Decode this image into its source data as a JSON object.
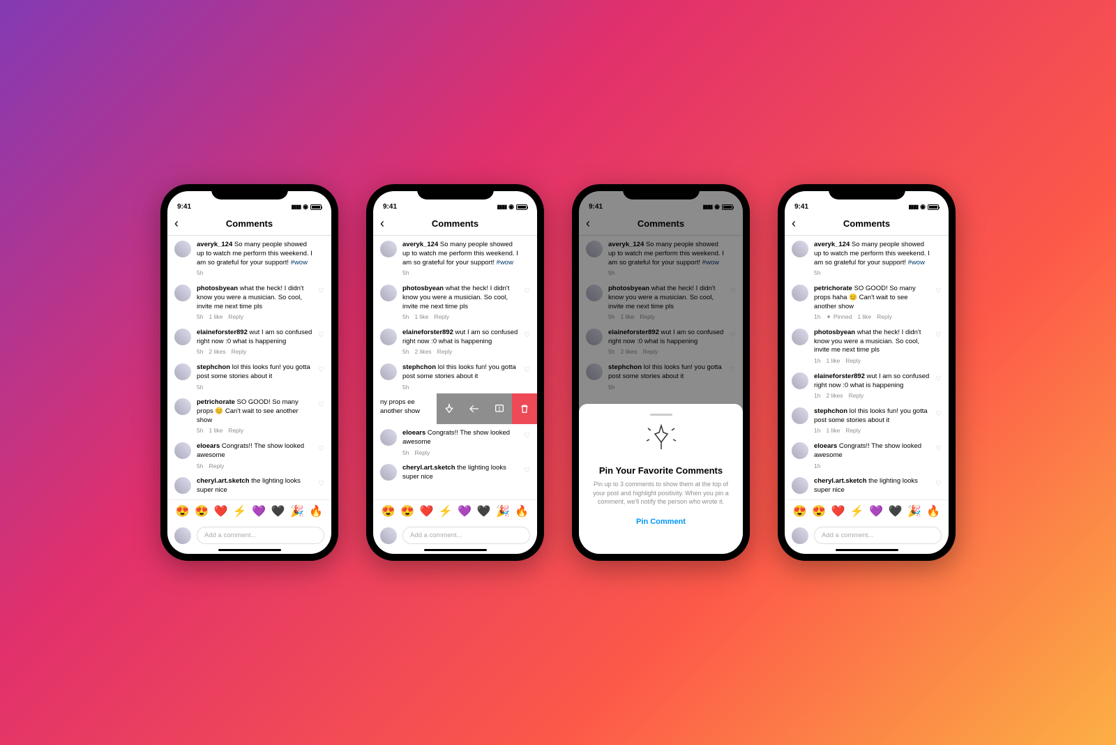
{
  "status_time": "9:41",
  "header_title": "Comments",
  "input_placeholder": "Add a comment...",
  "emojis": [
    "😍",
    "😍",
    "❤️",
    "⚡",
    "💜",
    "🖤",
    "🎉",
    "🔥"
  ],
  "post": {
    "user": "averyk_124",
    "text": "So many people showed up to watch me perform this weekend. I am so grateful for your support! ",
    "hashtag": "#wow",
    "time": "5h"
  },
  "comments": [
    {
      "user": "photosbyean",
      "text": "what the heck! I didn't know you were a musician. So cool, invite me next time pls",
      "time": "5h",
      "likes": "1 like",
      "reply": "Reply"
    },
    {
      "user": "elaineforster892",
      "text": "wut I am so confused right now :0 what is happening",
      "time": "5h",
      "likes": "2 likes",
      "reply": "Reply"
    },
    {
      "user": "stephchon",
      "text": "lol this looks fun! you gotta post some stories about it",
      "time": "5h",
      "likes": "",
      "reply": ""
    },
    {
      "user": "petrichorate",
      "text": "SO GOOD! So many props 😊 Can't wait to see another show",
      "time": "5h",
      "likes": "1 like",
      "reply": "Reply"
    },
    {
      "user": "eloears",
      "text": "Congrats!! The show looked awesome",
      "time": "5h",
      "likes": "",
      "reply": "Reply"
    },
    {
      "user": "cheryl.art.sketch",
      "text": "the lighting looks super nice",
      "time": "",
      "likes": "",
      "reply": ""
    }
  ],
  "swipe_peek": "ny props \nee another show",
  "sheet": {
    "title": "Pin Your Favorite Comments",
    "body": "Pin up to 3 comments to show them at the top of your post and highlight positivity. When you pin a comment, we'll notify the person who wrote it.",
    "action": "Pin Comment"
  },
  "phone4": {
    "pinned": {
      "user": "petrichorate",
      "text": "SO GOOD! So many props haha 😊 Can't wait to see another show",
      "time": "1h",
      "pinned_label": "Pinned",
      "likes": "1 like",
      "reply": "Reply"
    },
    "rest": [
      {
        "user": "photosbyean",
        "text": "what the heck! I didn't know you were a musician. So cool, invite me next time pls",
        "time": "1h",
        "likes": "1 like",
        "reply": "Reply"
      },
      {
        "user": "elaineforster892",
        "text": "wut I am so confused right now :0 what is happening",
        "time": "1h",
        "likes": "2 likes",
        "reply": "Reply"
      },
      {
        "user": "stephchon",
        "text": "lol this looks fun! you gotta post some stories about it",
        "time": "1h",
        "likes": "1 like",
        "reply": "Reply"
      },
      {
        "user": "eloears",
        "text": "Congrats!! The show looked awesome",
        "time": "1h",
        "likes": "",
        "reply": ""
      },
      {
        "user": "cheryl.art.sketch",
        "text": "the lighting looks super nice",
        "time": "",
        "likes": "",
        "reply": ""
      }
    ]
  }
}
